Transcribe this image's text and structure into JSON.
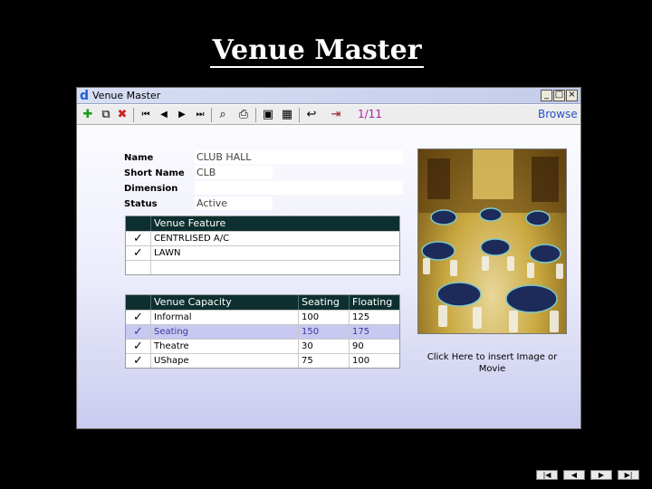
{
  "slide": {
    "title": "Venue Master"
  },
  "window": {
    "title": "Venue Master",
    "controls": {
      "minimize": "_",
      "maximize": "□",
      "close": "×"
    }
  },
  "toolbar": {
    "icons": [
      "add-icon",
      "copy-icon",
      "delete-icon",
      "first-record-icon",
      "previous-record-icon",
      "next-record-icon",
      "last-record-icon",
      "find-icon",
      "print-icon",
      "save-icon",
      "save-close-icon",
      "undo-icon",
      "exit-icon"
    ],
    "record_count": "1/11",
    "browse_label": "Browse"
  },
  "form": {
    "name": {
      "label": "Name",
      "value": "CLUB HALL"
    },
    "short_name": {
      "label": "Short Name",
      "value": "CLB"
    },
    "dimension": {
      "label": "Dimension",
      "value": ""
    },
    "status": {
      "label": "Status",
      "value": "Active"
    }
  },
  "feature_grid": {
    "header": "Venue Feature",
    "rows": [
      {
        "checked": "✓",
        "name": "CENTRLISED A/C"
      },
      {
        "checked": "✓",
        "name": "LAWN"
      },
      {
        "checked": "",
        "name": ""
      }
    ]
  },
  "capacity_grid": {
    "headers": {
      "name": "Venue Capacity",
      "seating": "Seating",
      "floating": "Floating"
    },
    "rows": [
      {
        "checked": "✓",
        "name": "Informal",
        "seating": "100",
        "floating": "125"
      },
      {
        "checked": "✓",
        "name": "Seating",
        "seating": "150",
        "floating": "175"
      },
      {
        "checked": "✓",
        "name": "Theatre",
        "seating": "30",
        "floating": "90"
      },
      {
        "checked": "✓",
        "name": "UShape",
        "seating": "75",
        "floating": "100"
      }
    ]
  },
  "image_panel": {
    "insert_link": "Click Here to insert Image or Movie"
  },
  "slide_nav": {
    "first": "|◀",
    "previous": "◀",
    "next": "▶",
    "last": "▶|"
  },
  "colors": {
    "grid_header": "#0e2f2f",
    "record_count": "#b020a0",
    "browse": "#2a4fc0",
    "selected_row": "#c8c8f0"
  }
}
